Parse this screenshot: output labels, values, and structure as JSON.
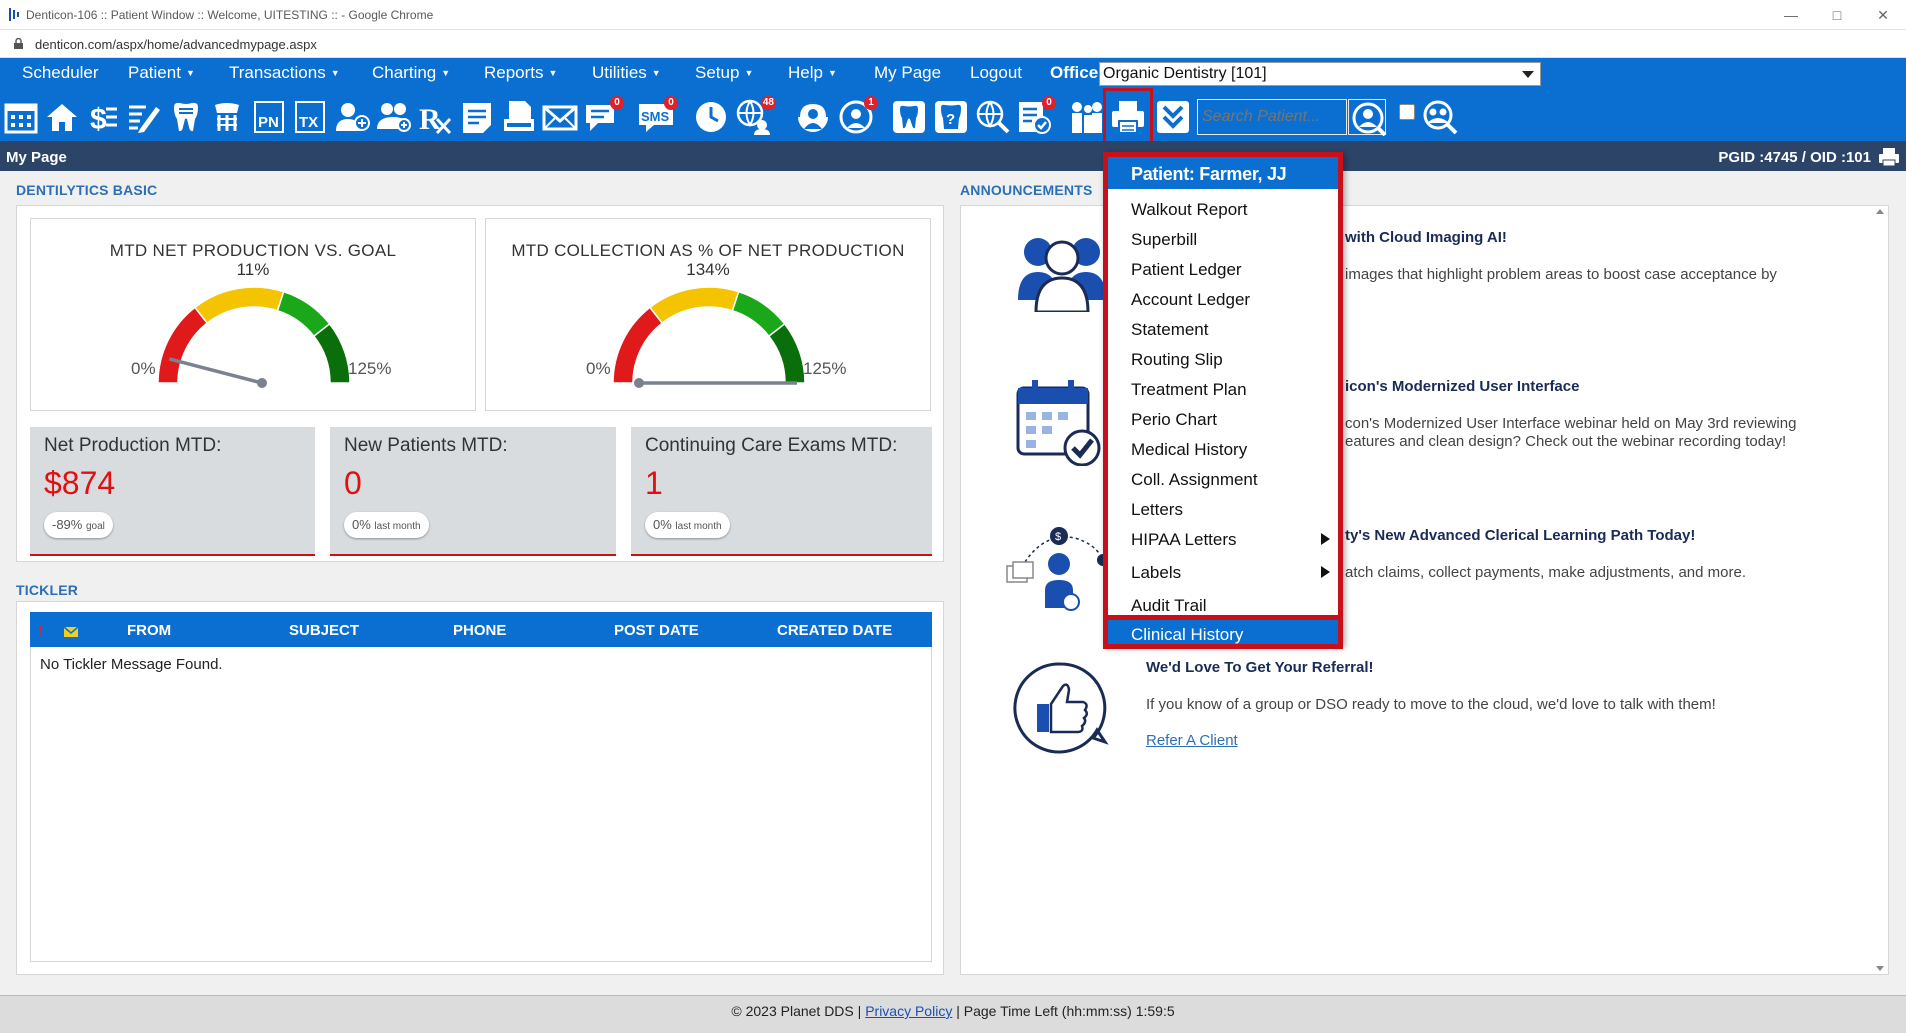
{
  "window": {
    "title": "Denticon-106 :: Patient Window :: Welcome, UITESTING :: - Google Chrome",
    "url": "denticon.com/aspx/home/advancedmypage.aspx"
  },
  "menu": {
    "scheduler": "Scheduler",
    "patient": "Patient",
    "transactions": "Transactions",
    "charting": "Charting",
    "reports": "Reports",
    "utilities": "Utilities",
    "setup": "Setup",
    "help": "Help",
    "mypage": "My Page",
    "logout": "Logout",
    "office_label": "Office",
    "office_value": "Organic Dentistry [101]"
  },
  "toolbar": {
    "search_placeholder": "Search Patient...",
    "badges": {
      "sms": "0",
      "referrals": "48",
      "alerts": "1",
      "messages": "0",
      "forms": "0"
    },
    "colors": {
      "bar": "#0a6fd0",
      "highlight": "#c8101a"
    }
  },
  "pagebar": {
    "title": "My Page",
    "ids": "PGID :4745  /  OID :101"
  },
  "dashboard": {
    "section_title": "DENTILYTICS BASIC",
    "gauges": [
      {
        "title": "MTD NET PRODUCTION VS. GOAL",
        "pct": "11%",
        "value_pct": 11,
        "min": "0%",
        "max": "125%"
      },
      {
        "title": "MTD COLLECTION AS % OF NET PRODUCTION",
        "pct": "134%",
        "value_pct": 134,
        "min": "0%",
        "max": "125%"
      }
    ],
    "kpis": [
      {
        "label": "Net Production MTD:",
        "value": "$874",
        "pill_value": "-89%",
        "pill_note": "goal"
      },
      {
        "label": "New Patients MTD:",
        "value": "0",
        "pill_value": "0%",
        "pill_note": "last month"
      },
      {
        "label": "Continuing Care Exams MTD:",
        "value": "1",
        "pill_value": "0%",
        "pill_note": "last month"
      }
    ]
  },
  "tickler": {
    "section_title": "TICKLER",
    "columns": [
      "FROM",
      "SUBJECT",
      "PHONE",
      "POST DATE",
      "CREATED DATE"
    ],
    "empty_text": "No Tickler Message Found."
  },
  "announcements": {
    "section_title": "ANNOUNCEMENTS",
    "items": [
      {
        "title": "with Cloud Imaging AI!",
        "text": "images that highlight problem areas to boost case acceptance by"
      },
      {
        "title": "icon's Modernized User Interface",
        "text_line1": "con's Modernized User Interface webinar held on May 3rd reviewing",
        "text_line2": "eatures and clean design? Check out the webinar recording today!"
      },
      {
        "title": "ty's New Advanced Clerical Learning Path Today!",
        "text": "atch claims, collect payments, make adjustments, and more."
      },
      {
        "title": "We'd Love To Get Your Referral!",
        "text": "If you know of a group or DSO ready to move to the cloud, we'd love to talk with them!",
        "link": "Refer A Client"
      }
    ]
  },
  "print_menu": {
    "header": "Patient: Farmer, JJ",
    "items": [
      "Walkout Report",
      "Superbill",
      "Patient Ledger",
      "Account Ledger",
      "Statement",
      "Routing Slip",
      "Treatment Plan",
      "Perio Chart",
      "Medical History",
      "Coll. Assignment",
      "Letters",
      "HIPAA Letters",
      "Labels",
      "Audit Trail"
    ],
    "highlighted_item": "Clinical History"
  },
  "footer": {
    "copyright": "© 2023 Planet DDS |",
    "privacy": "Privacy Policy",
    "time_left": "| Page Time Left (hh:mm:ss) 1:59:5"
  }
}
